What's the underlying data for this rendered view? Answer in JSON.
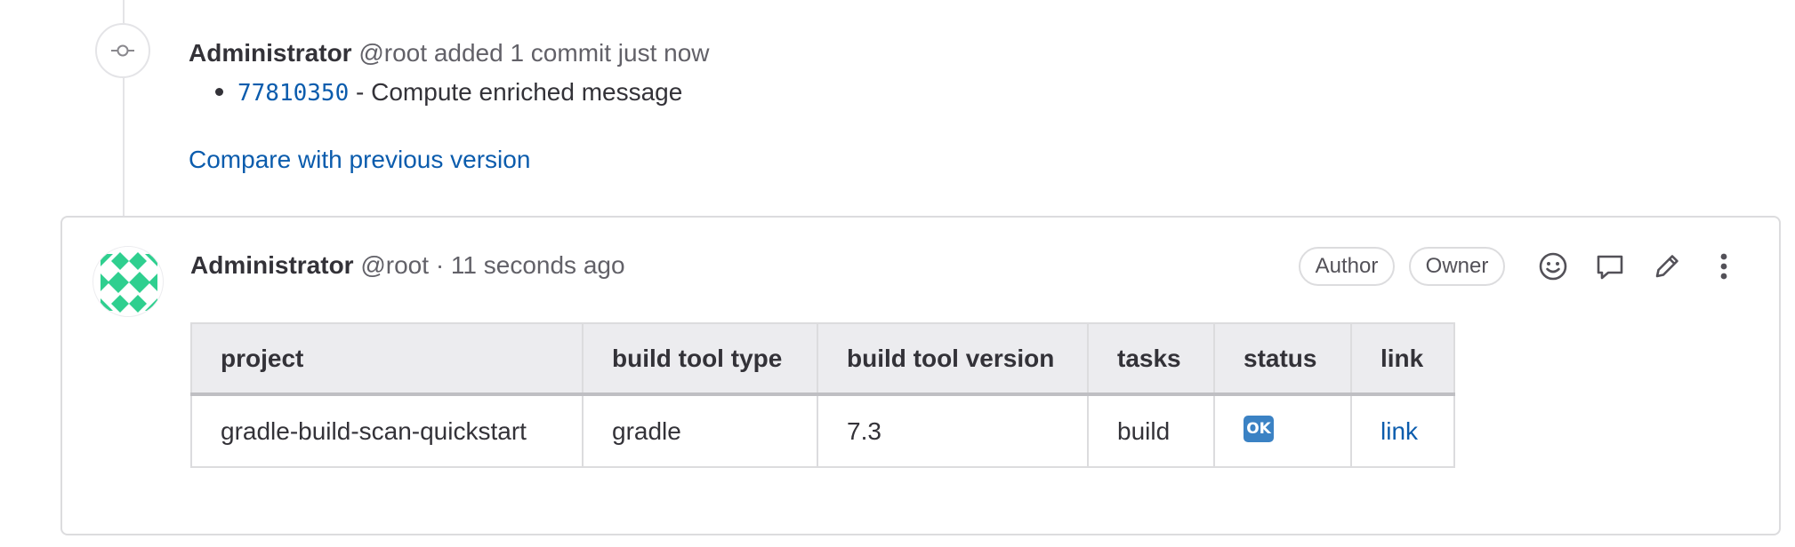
{
  "system_note": {
    "author_name": "Administrator",
    "author_handle": "@root",
    "action_text": "added 1 commit just now",
    "commit": {
      "sha": "77810350",
      "separator": " - ",
      "message": "Compute enriched message"
    },
    "compare_link": "Compare with previous version",
    "icon": "commit-icon"
  },
  "note": {
    "author_name": "Administrator",
    "author_handle": "@root",
    "separator": "·",
    "time_ago": "11 seconds ago",
    "badges": {
      "author": "Author",
      "owner": "Owner"
    },
    "actions": {
      "emoji_icon": "smiley-icon",
      "reply_icon": "comment-icon",
      "edit_icon": "pencil-icon",
      "more_icon": "kebab-menu-icon"
    },
    "table": {
      "headers": {
        "project": "project",
        "build_tool_type": "build tool type",
        "build_tool_version": "build tool version",
        "tasks": "tasks",
        "status": "status",
        "link": "link"
      },
      "rows": [
        {
          "project": "gradle-build-scan-quickstart",
          "build_tool_type": "gradle",
          "build_tool_version": "7.3",
          "tasks": "build",
          "status": "OK",
          "link": "link"
        }
      ]
    }
  },
  "colors": {
    "link": "#0b5cad",
    "text": "#333238",
    "muted": "#626168",
    "border": "#dcdcde",
    "table_header_bg": "#ececef",
    "avatar_accent": "#2fcf8f",
    "ok_badge": "#3b82c4"
  }
}
